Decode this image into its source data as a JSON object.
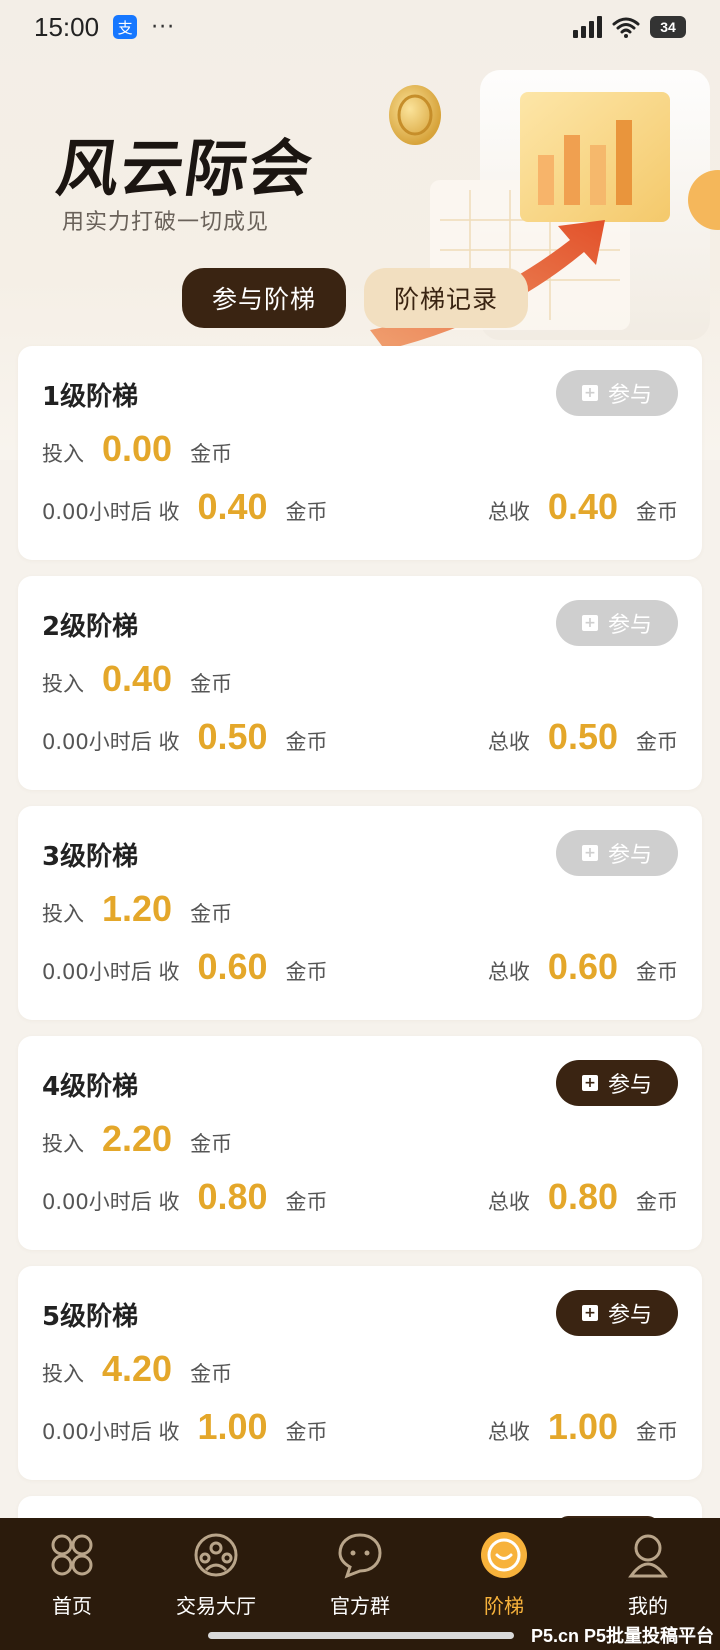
{
  "status_bar": {
    "time": "15:00",
    "app_glyph": "支",
    "dots": "···",
    "battery": "34"
  },
  "hero": {
    "title": "风云际会",
    "subtitle": "用实力打破一切成见"
  },
  "tabs": [
    {
      "label": "参与阶梯",
      "active": true
    },
    {
      "label": "阶梯记录",
      "active": false
    }
  ],
  "labels": {
    "invest": "投入",
    "coin": "金币",
    "receive_prefix": "小时后 收",
    "total": "总收",
    "join": "参与"
  },
  "ladders": [
    {
      "title": "1级阶梯",
      "invest": "0.00",
      "hours": "0.00",
      "receive": "0.40",
      "total": "0.40",
      "join_enabled": false
    },
    {
      "title": "2级阶梯",
      "invest": "0.40",
      "hours": "0.00",
      "receive": "0.50",
      "total": "0.50",
      "join_enabled": false
    },
    {
      "title": "3级阶梯",
      "invest": "1.20",
      "hours": "0.00",
      "receive": "0.60",
      "total": "0.60",
      "join_enabled": false
    },
    {
      "title": "4级阶梯",
      "invest": "2.20",
      "hours": "0.00",
      "receive": "0.80",
      "total": "0.80",
      "join_enabled": true
    },
    {
      "title": "5级阶梯",
      "invest": "4.20",
      "hours": "0.00",
      "receive": "1.00",
      "total": "1.00",
      "join_enabled": true
    }
  ],
  "bottom_nav": [
    {
      "label": "首页",
      "icon": "home-grid-icon",
      "active": false
    },
    {
      "label": "交易大厅",
      "icon": "trade-hall-icon",
      "active": false
    },
    {
      "label": "官方群",
      "icon": "chat-bubble-icon",
      "active": false
    },
    {
      "label": "阶梯",
      "icon": "ladder-coin-icon",
      "active": true
    },
    {
      "label": "我的",
      "icon": "profile-icon",
      "active": false
    }
  ],
  "watermark": "P5.cn P5批量投稿平台",
  "colors": {
    "accent_dark": "#3a2412",
    "accent_gold": "#e4a72a",
    "nav_active": "#f7b23b",
    "disabled_button": "#cfcfcf"
  }
}
